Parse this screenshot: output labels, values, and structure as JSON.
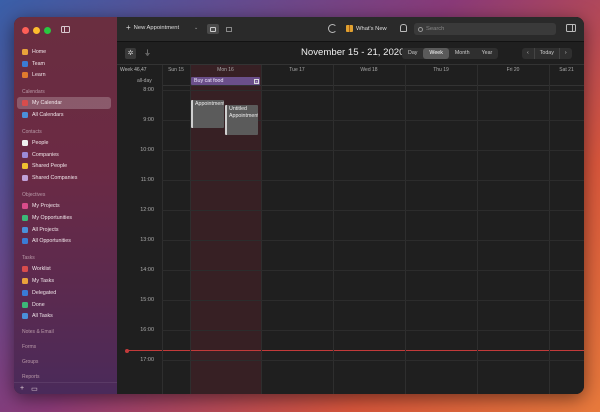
{
  "sidebar": {
    "items": [
      {
        "label": "Home",
        "icon": "home-icon",
        "color": "#e9a23b"
      },
      {
        "label": "Team",
        "icon": "team-icon",
        "color": "#3a7bd5"
      },
      {
        "label": "Learn",
        "icon": "learn-icon",
        "color": "#e07b2e"
      }
    ],
    "sections": [
      {
        "title": "Calendars",
        "items": [
          {
            "label": "My Calendar",
            "icon": "calendar-icon",
            "color": "#d94c4c",
            "selected": true
          },
          {
            "label": "All Calendars",
            "icon": "calendars-icon",
            "color": "#4a8fd9"
          }
        ]
      },
      {
        "title": "Contacts",
        "items": [
          {
            "label": "People",
            "icon": "person-icon",
            "color": "#f0f0f0"
          },
          {
            "label": "Companies",
            "icon": "company-icon",
            "color": "#9c8ad8"
          },
          {
            "label": "Shared People",
            "icon": "shared-people-icon",
            "color": "#f0c030"
          },
          {
            "label": "Shared Companies",
            "icon": "shared-companies-icon",
            "color": "#c0a0d8"
          }
        ]
      },
      {
        "title": "Objectives",
        "items": [
          {
            "label": "My Projects",
            "icon": "project-icon",
            "color": "#d94c8a"
          },
          {
            "label": "My Opportunities",
            "icon": "opportunity-icon",
            "color": "#3cb878"
          },
          {
            "label": "All Projects",
            "icon": "all-projects-icon",
            "color": "#4a8fd9"
          },
          {
            "label": "All Opportunities",
            "icon": "all-opportunities-icon",
            "color": "#3a7bd5"
          }
        ]
      },
      {
        "title": "Tasks",
        "items": [
          {
            "label": "Worklist",
            "icon": "worklist-icon",
            "color": "#d94c4c"
          },
          {
            "label": "My Tasks",
            "icon": "my-tasks-icon",
            "color": "#e9a23b"
          },
          {
            "label": "Delegated",
            "icon": "delegated-icon",
            "color": "#3a7bd5"
          },
          {
            "label": "Done",
            "icon": "done-icon",
            "color": "#3cb878"
          },
          {
            "label": "All Tasks",
            "icon": "all-tasks-icon",
            "color": "#4a8fd9"
          }
        ]
      }
    ],
    "collapsed_sections": [
      "Notes & Email",
      "Forms",
      "Groups",
      "Reports"
    ],
    "bottom": {
      "add": "+",
      "panel": "▭"
    }
  },
  "toolbar": {
    "new_label": "New Appointment",
    "whats_new": "What's New",
    "search_placeholder": "Search"
  },
  "calendar": {
    "title": "November 15 - 21, 2020",
    "views": [
      "Day",
      "Week",
      "Month",
      "Year"
    ],
    "active_view": "Week",
    "prev": "‹",
    "today": "Today",
    "next": "›",
    "week_label": "Week 46,47",
    "allday_label": "all-day",
    "days": [
      "Sun 15",
      "Mon 16",
      "Tue 17",
      "Wed 18",
      "Thu 19",
      "Fri 20",
      "Sat 21"
    ],
    "hours": [
      "8:00",
      "9:00",
      "10:00",
      "11:00",
      "12:00",
      "13:00",
      "14:00",
      "15:00",
      "16:00",
      "17:00"
    ],
    "allday_event": {
      "title": "Buy cat food",
      "day": "Mon 16"
    },
    "events": [
      {
        "title": "Appointment",
        "day": "Mon 16",
        "start": "8:20",
        "end": "9:15"
      },
      {
        "title": "Untitled Appointment",
        "day": "Mon 16",
        "start": "8:30",
        "end": "9:30"
      }
    ],
    "current_time": "16:00",
    "colors": {
      "now": "#c23a3a",
      "allday_event": "#6b4f8a",
      "today_col": "#7a2332"
    }
  }
}
